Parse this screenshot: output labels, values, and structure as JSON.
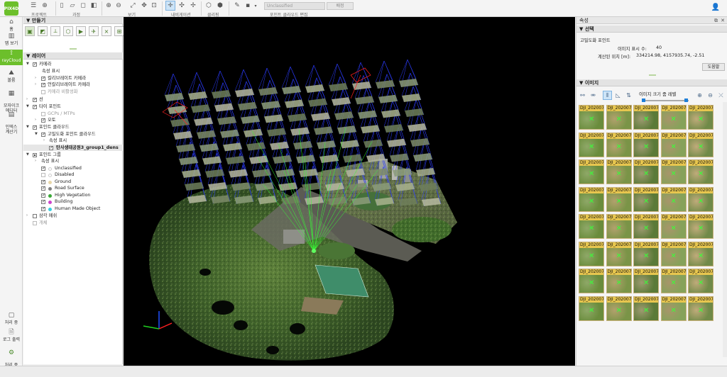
{
  "toolbar": {
    "logo_label": "PIX4D",
    "groups": [
      {
        "label": "프로젝트"
      },
      {
        "label": "과정"
      },
      {
        "label": "보기"
      },
      {
        "label": "내비게이션"
      },
      {
        "label": "클리핑"
      },
      {
        "label": "포인트 클라우드 편집"
      }
    ],
    "class_select_value": "Unclassified",
    "apply_label": "배정"
  },
  "leftbar": {
    "items": [
      {
        "label": "홈"
      },
      {
        "label": "맵 보기"
      },
      {
        "label": "rayCloud"
      },
      {
        "label": "볼륨"
      },
      {
        "label": "모자이크\n에디터"
      },
      {
        "label": "인덱스\n계산기"
      },
      {
        "label": "처리 중"
      },
      {
        "label": "로그 출력"
      },
      {
        "label": "처리 중\n옵션"
      }
    ]
  },
  "left_panel": {
    "create_header": "만들기",
    "layers_header": "레이어",
    "tree": [
      {
        "text": "카메라",
        "checked": true
      },
      {
        "text": "속성 표시"
      },
      {
        "text": "칼리브레이트 카메라",
        "checked": true
      },
      {
        "text": "언칼리브레이트 카메라",
        "checked": true
      },
      {
        "text": "카메라 비활성화"
      },
      {
        "text": "선",
        "checked": true
      },
      {
        "text": "타이 포인트",
        "checked": true
      },
      {
        "text": "GCPs / MTPs"
      },
      {
        "text": "오토",
        "checked": true
      },
      {
        "text": "포인트 클라우드",
        "checked": true
      },
      {
        "text": "고밀도화 포인트 클라우드",
        "checked": true
      },
      {
        "text": "속성 표시"
      },
      {
        "text": "탄사생태공원3_group1_dens",
        "checked": true
      },
      {
        "text": "포인트 그룹"
      },
      {
        "text": "속성 표시"
      },
      {
        "text": "Unclassified",
        "checked": true
      },
      {
        "text": "Disabled"
      },
      {
        "text": "Ground",
        "checked": true
      },
      {
        "text": "Road Surface",
        "checked": true
      },
      {
        "text": "High Vegetation",
        "checked": true
      },
      {
        "text": "Building",
        "checked": true
      },
      {
        "text": "Human Made Object",
        "checked": true
      },
      {
        "text": "삼각 메쉬"
      },
      {
        "text": "개체"
      }
    ],
    "class_colors": {
      "unclassified": "#ffffff",
      "disabled": "#ffffff",
      "ground": "#e8d7a8",
      "road_surface": "#808080",
      "high_vegetation": "#3aa837",
      "building": "#cc44cc",
      "human_made_object": "#35cfe0"
    }
  },
  "right_panel": {
    "title": "속성",
    "selection_header": "선택",
    "selected_item": "고밀도화 포인트",
    "image_count_label": "이미지 표시 수:",
    "image_count_value": "40",
    "computed_pos_label": "계산된 위치 [m]:",
    "computed_pos_value": "334214.98, 4157935.74, -2.51",
    "help_button": "도움말",
    "images_header": "이미지",
    "image_size_label": "이미지 크기 줌 레벨",
    "thumb_label": "DJI_202007",
    "thumb_count": 40,
    "thumb_colors": {
      "label_bg": "#e7c64f",
      "marker": "#38ff38"
    }
  },
  "viewport": {
    "background": "#000000",
    "axis_colors": {
      "x": "#ff2020",
      "y": "#20d020",
      "z": "#2050ff"
    }
  }
}
